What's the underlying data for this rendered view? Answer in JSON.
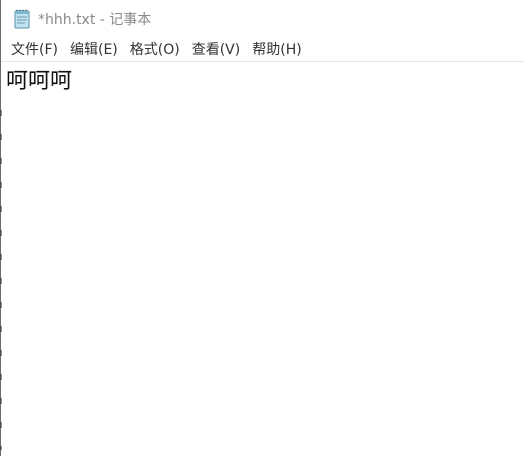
{
  "window": {
    "title": "*hhh.txt - 记事本",
    "icon": "notepad-icon"
  },
  "menu": {
    "items": [
      {
        "label": "文件(F)"
      },
      {
        "label": "编辑(E)"
      },
      {
        "label": "格式(O)"
      },
      {
        "label": "查看(V)"
      },
      {
        "label": "帮助(H)"
      }
    ]
  },
  "editor": {
    "content": "呵呵呵"
  },
  "colors": {
    "title_text": "#8a8a8a",
    "menu_text": "#333333",
    "editor_text": "#111111"
  }
}
